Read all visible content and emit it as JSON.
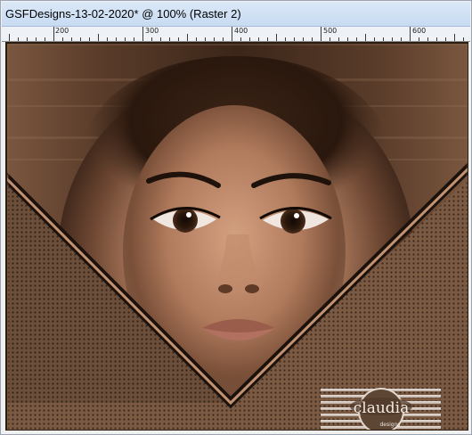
{
  "window": {
    "title": "GSFDesigns-13-02-2020* @ 100% (Raster 2)"
  },
  "ruler": {
    "labels": [
      "200",
      "300",
      "400",
      "500",
      "600"
    ]
  },
  "watermark": {
    "text": "claudia",
    "subtext": "designs"
  },
  "colors": {
    "titlebar": "#c7dbf2",
    "frame_brown": "#6b4a33",
    "dark_border": "#1c120b",
    "copper": "#c29373"
  }
}
